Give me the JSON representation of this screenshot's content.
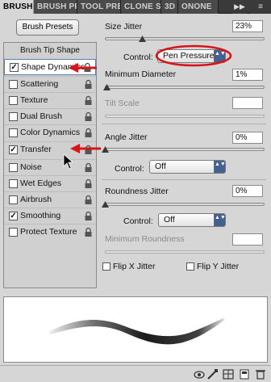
{
  "tabs": [
    {
      "label": "BRUSH",
      "active": true
    },
    {
      "label": "BRUSH PRE"
    },
    {
      "label": "TOOL PRE"
    },
    {
      "label": "CLONE SO"
    },
    {
      "label": "3D"
    },
    {
      "label": "ONONE"
    }
  ],
  "tabbar": {
    "overflow_arrows": "▶▶",
    "menu_glyph": "≡"
  },
  "brush_presets_button": "Brush Presets",
  "tip_shape_label": "Brush Tip Shape",
  "options": [
    {
      "label": "Shape Dynamics",
      "checked": true,
      "selected": true
    },
    {
      "label": "Scattering",
      "checked": false
    },
    {
      "label": "Texture",
      "checked": false
    },
    {
      "label": "Dual Brush",
      "checked": false
    },
    {
      "label": "Color Dynamics",
      "checked": false
    },
    {
      "label": "Transfer",
      "checked": true
    },
    {
      "label": "Noise",
      "checked": false
    },
    {
      "label": "Wet Edges",
      "checked": false
    },
    {
      "label": "Airbrush",
      "checked": false
    },
    {
      "label": "Smoothing",
      "checked": true
    },
    {
      "label": "Protect Texture",
      "checked": false
    }
  ],
  "check_glyph": "✓",
  "size_jitter": {
    "label": "Size Jitter",
    "value": "23%",
    "level": 0.23
  },
  "control1": {
    "label": "Control:",
    "value": "Pen Pressure"
  },
  "minimum_diameter": {
    "label": "Minimum Diameter",
    "value": "1%",
    "level": 0.01
  },
  "tilt_scale": {
    "label": "Tilt Scale",
    "value": ""
  },
  "angle_jitter": {
    "label": "Angle Jitter",
    "value": "0%",
    "level": 0.0
  },
  "control2": {
    "label": "Control:",
    "value": "Off"
  },
  "roundness_jitter": {
    "label": "Roundness Jitter",
    "value": "0%",
    "level": 0.0
  },
  "control3": {
    "label": "Control:",
    "value": "Off"
  },
  "minimum_roundness": {
    "label": "Minimum Roundness",
    "value": ""
  },
  "flip_x": {
    "label": "Flip X Jitter",
    "checked": false
  },
  "flip_y": {
    "label": "Flip Y Jitter",
    "checked": false
  },
  "select_arrows": "▲▼",
  "colors": {
    "annotation": "#d8141b",
    "panel": "#d6d6d6",
    "selected_accent": "#5a7fb5",
    "select_arrows_bg": "#43608e"
  }
}
